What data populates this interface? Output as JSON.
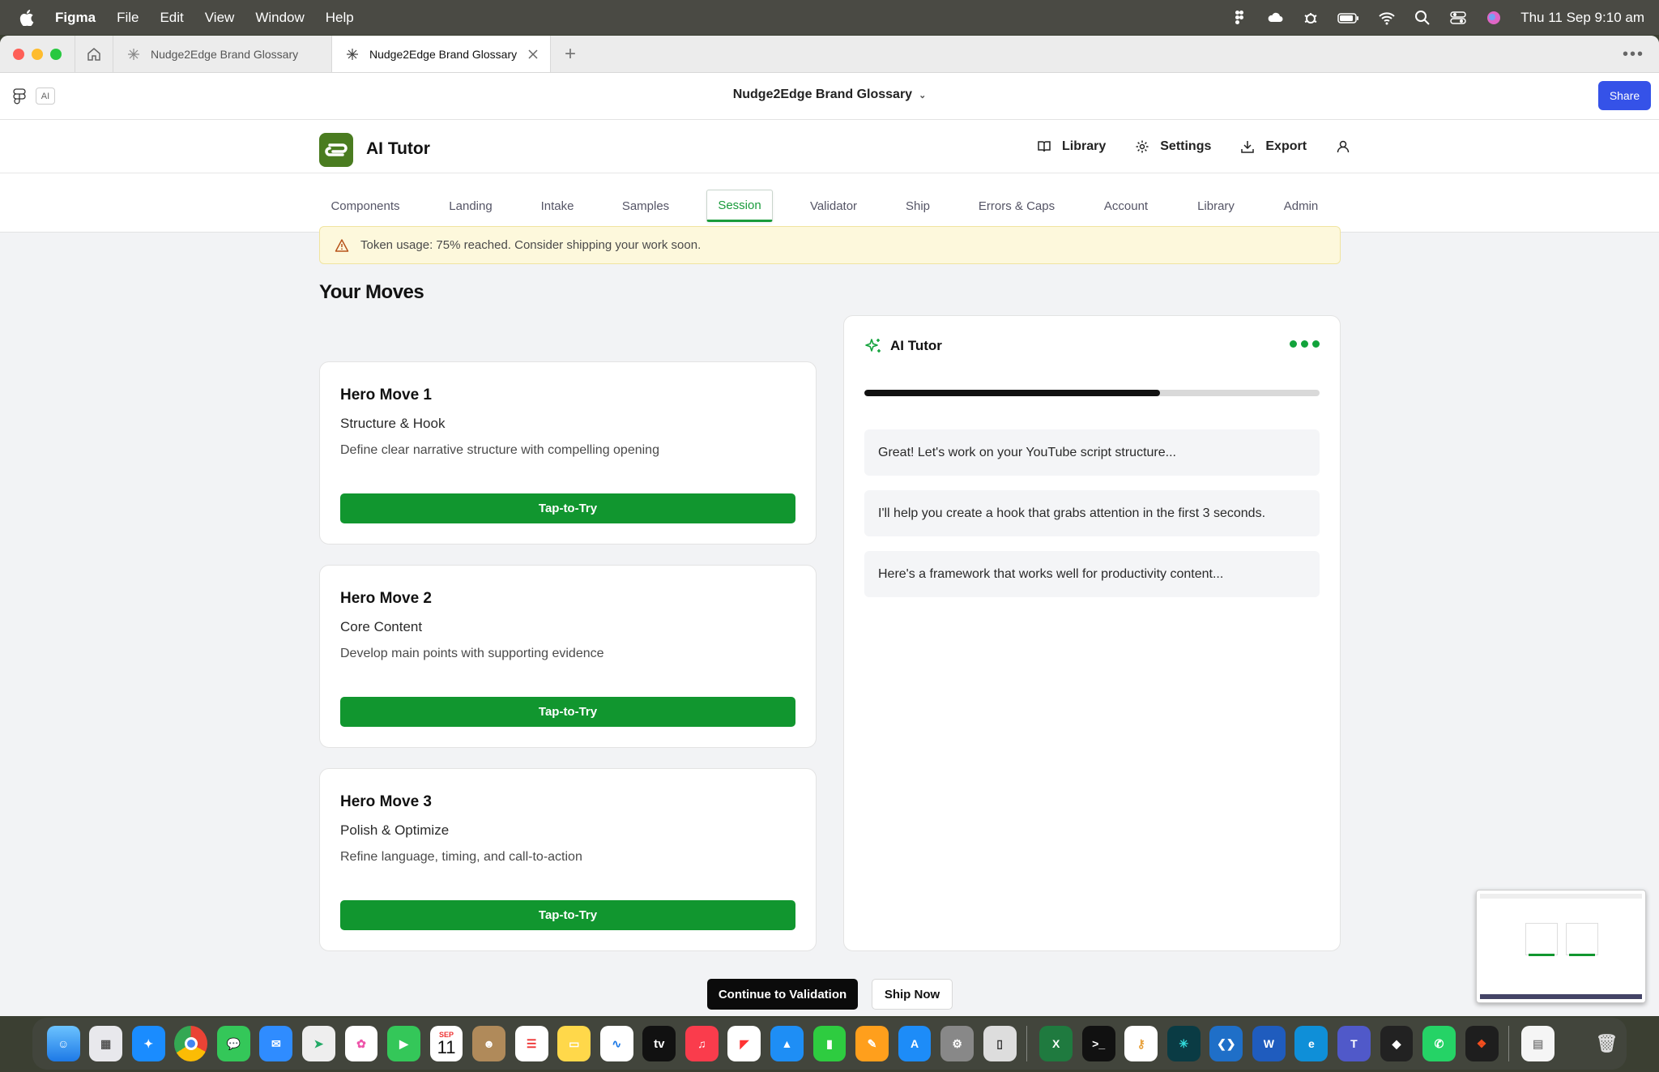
{
  "menubar": {
    "app_name": "Figma",
    "menus": [
      "File",
      "Edit",
      "View",
      "Window",
      "Help"
    ],
    "clock": "Thu 11 Sep  9:10 am"
  },
  "tabs": [
    {
      "label": "Nudge2Edge Brand Glossary",
      "active": false
    },
    {
      "label": "Nudge2Edge Brand Glossary",
      "active": true
    }
  ],
  "toolbar": {
    "ai_badge": "AI",
    "doc_title": "Nudge2Edge Brand Glossary",
    "share_label": "Share"
  },
  "app": {
    "name": "AI Tutor",
    "actions": {
      "library": "Library",
      "settings": "Settings",
      "export": "Export"
    }
  },
  "nav": {
    "items": [
      "Components",
      "Landing",
      "Intake",
      "Samples",
      "Session",
      "Validator",
      "Ship",
      "Errors & Caps",
      "Account",
      "Library",
      "Admin"
    ],
    "active": "Session"
  },
  "alert": {
    "text": "Token usage: 75% reached. Consider shipping your work soon."
  },
  "moves": {
    "title": "Your Moves",
    "cards": [
      {
        "title": "Hero Move 1",
        "subtitle": "Structure & Hook",
        "description": "Define clear narrative structure with compelling opening",
        "button": "Tap-to-Try"
      },
      {
        "title": "Hero Move 2",
        "subtitle": "Core Content",
        "description": "Develop main points with supporting evidence",
        "button": "Tap-to-Try"
      },
      {
        "title": "Hero Move 3",
        "subtitle": "Polish & Optimize",
        "description": "Refine language, timing, and call-to-action",
        "button": "Tap-to-Try"
      }
    ]
  },
  "tutor": {
    "title": "AI Tutor",
    "progress_percent": 65,
    "messages": [
      "Great! Let's work on your YouTube script structure...",
      "I'll help you create a hook that grabs attention in the first 3 seconds.",
      "Here's a framework that works well for productivity content..."
    ]
  },
  "actions": {
    "continue_label": "Continue to Validation",
    "ship_label": "Ship Now"
  },
  "dock": {
    "calendar_month": "SEP",
    "calendar_day": "11",
    "tv_label": "tv"
  },
  "colors": {
    "accent_green": "#11962f",
    "share_blue": "#3552e8",
    "alert_bg": "#fdf8dc"
  }
}
